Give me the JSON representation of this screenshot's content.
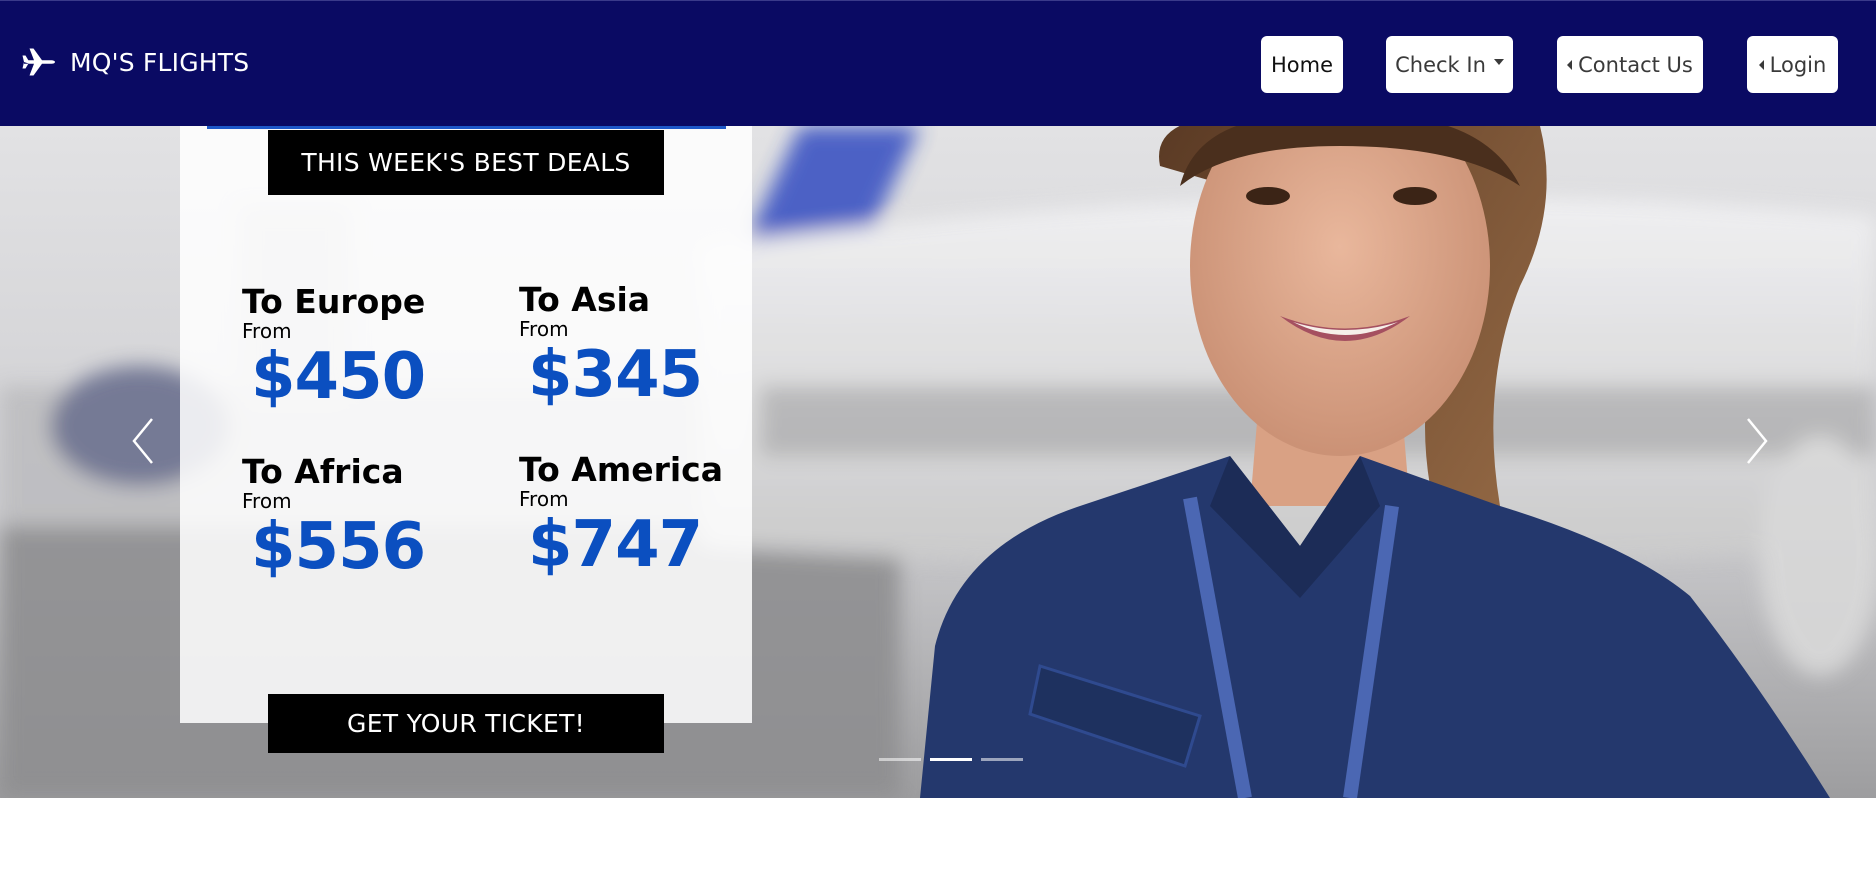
{
  "navbar": {
    "brand_icon": "airplane-icon",
    "brand_text": "MQ'S FLIGHTS",
    "background_color": "#0a0a63",
    "items": [
      {
        "label": "Home"
      },
      {
        "label": "Check In",
        "icon": "caret-down-icon"
      },
      {
        "label": "Contact Us",
        "icon": "caret-left-icon"
      },
      {
        "label": "Login",
        "icon": "caret-left-icon"
      }
    ]
  },
  "hero": {
    "image": "flight-attendant-photo",
    "prev_icon": "chevron-left-icon",
    "next_icon": "chevron-right-icon",
    "indicator_count": 3,
    "active_indicator": 1
  },
  "deals": {
    "title": "THIS WEEK'S BEST DEALS",
    "accent_color": "#0b4fc0",
    "items": [
      {
        "destination": "To Europe",
        "from": "From",
        "price": "$450"
      },
      {
        "destination": "To Asia",
        "from": "From",
        "price": "$345"
      },
      {
        "destination": "To Africa",
        "from": "From",
        "price": "$556"
      },
      {
        "destination": "To America",
        "from": "From",
        "price": "$747"
      }
    ],
    "cta_label": "GET YOUR TICKET!"
  }
}
